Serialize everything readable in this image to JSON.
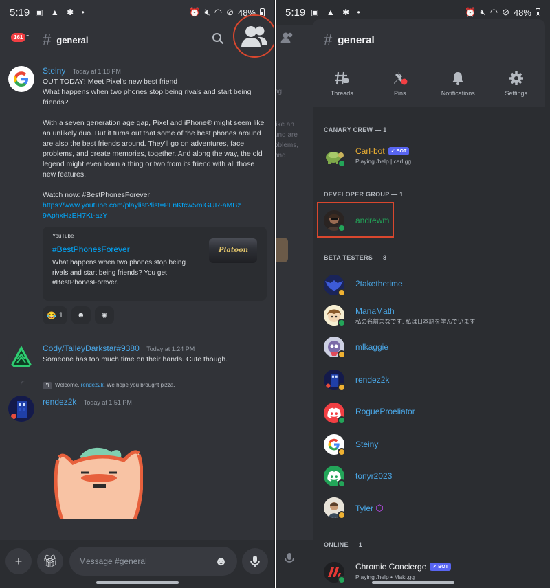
{
  "status_bar": {
    "time": "5:19",
    "battery": "48%"
  },
  "left": {
    "header": {
      "badge": "161",
      "channel": "general"
    },
    "messages": [
      {
        "author": "Steiny",
        "timestamp": "Today at 1:18 PM",
        "text": "OUT TODAY! Meet Pixel's new best friend\nWhat happens when two phones stop being rivals and start being friends?\n\nWith a seven generation age gap, Pixel and iPhone® might seem like an unlikely duo. But it turns out that some of the best phones around are also the best friends around. They'll go on adventures, face problems, and create memories, together. And along the way, the old legend might even learn a thing or two from its friend with all those\nnew features.\n\nWatch now: #BestPhonesForever",
        "link": "https://www.youtube.com/playlist?list=PLnKtcw5mlGUR-aMBz9AphxHzEH7Kt-azY",
        "embed": {
          "provider": "YouTube",
          "title": "#BestPhonesForever",
          "description": "What happens when two phones stop being rivals and start being friends? You get #BestPhonesForever.",
          "thumb_text": "Platoon"
        },
        "reaction_count": "1"
      },
      {
        "author": "Cody/TalleyDarkstar#9380",
        "timestamp": "Today at 1:24 PM",
        "text": "Someone has too much time on their hands.  Cute though."
      },
      {
        "reply_prefix": "Welcome,",
        "reply_mention": "rendez2k",
        "reply_suffix": ". We hope you brought pizza.",
        "author": "rendez2k",
        "timestamp": "Today at 1:51 PM"
      }
    ],
    "composer": {
      "placeholder": "Message #general"
    }
  },
  "right": {
    "header": {
      "channel": "general"
    },
    "tools": [
      {
        "label": "Threads",
        "icon": "threads-icon"
      },
      {
        "label": "Pins",
        "icon": "pin-icon"
      },
      {
        "label": "Notifications",
        "icon": "bell-icon"
      },
      {
        "label": "Settings",
        "icon": "gear-icon"
      }
    ],
    "sections": [
      {
        "title": "CANARY CREW — 1"
      },
      {
        "title": "DEVELOPER GROUP — 1"
      },
      {
        "title": "BETA TESTERS — 8"
      },
      {
        "title": "ONLINE — 1"
      }
    ],
    "members": [
      {
        "name": "Carl-bot",
        "badge": "BOT",
        "sub": "Playing /help | carl.gg",
        "color": "#f0b232",
        "status": "online"
      },
      {
        "name": "andrewm",
        "color": "#23a559",
        "status": "online"
      },
      {
        "name": "2takethetime",
        "color": "#4aa8e8",
        "status": "idle"
      },
      {
        "name": "ManaMath",
        "sub": "私の名前まなです. 私は日本語を学んでいます.",
        "color": "#4aa8e8",
        "status": "online"
      },
      {
        "name": "mlkaggie",
        "color": "#4aa8e8",
        "status": "idle"
      },
      {
        "name": "rendez2k",
        "color": "#4aa8e8",
        "status": "idle"
      },
      {
        "name": "RogueProeliator",
        "color": "#4aa8e8",
        "status": "online"
      },
      {
        "name": "Steiny",
        "color": "#4aa8e8",
        "status": "idle"
      },
      {
        "name": "tonyr2023",
        "color": "#4aa8e8",
        "status": "online"
      },
      {
        "name": "Tyler",
        "color": "#4aa8e8",
        "status": "idle"
      },
      {
        "name": "Chromie Concierge",
        "badge": "BOT",
        "sub": "Playing /help • Maki.gg",
        "color": "#f2f3f5",
        "status": "online"
      }
    ],
    "peek_text": [
      "ng",
      "like an",
      "und are",
      "oblems,",
      "ond"
    ]
  }
}
